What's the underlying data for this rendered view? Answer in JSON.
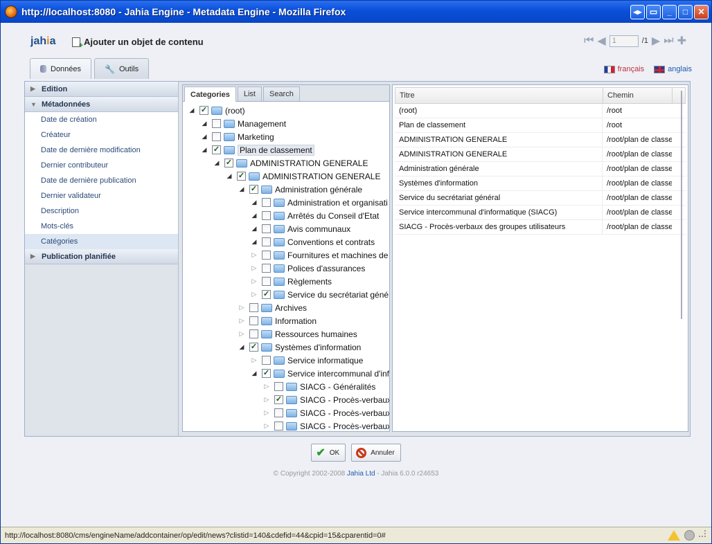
{
  "window": {
    "title": "http://localhost:8080 - Jahia Engine - Metadata Engine - Mozilla Firefox",
    "buttons": [
      "restore",
      "menu",
      "minimize",
      "maximize",
      "close"
    ]
  },
  "header": {
    "logo_main": "jah",
    "logo_accent": "i",
    "logo_end": "a",
    "heading": "Ajouter un objet de contenu",
    "page_value": "1",
    "page_total": "/1"
  },
  "tabs": [
    {
      "label": "Données",
      "icon": "database-icon",
      "active": true
    },
    {
      "label": "Outils",
      "icon": "wrench-icon",
      "active": false
    }
  ],
  "languages": [
    {
      "label": "français",
      "icon": "flag-fr-icon"
    },
    {
      "label": "anglais",
      "icon": "flag-uk-icon"
    }
  ],
  "sidebar": {
    "edition": "Edition",
    "metadonnees": "Métadonnées",
    "items": [
      "Date de création",
      "Créateur",
      "Date de dernière modification",
      "Dernier contributeur",
      "Date de dernière publication",
      "Dernier validateur",
      "Description",
      "Mots-clés",
      "Catégories"
    ],
    "selected_index": 8,
    "publication": "Publication planifiée"
  },
  "category_tabs": [
    "Categories",
    "List",
    "Search"
  ],
  "tree": [
    {
      "label": "(root)",
      "level": 0,
      "toggle": "open",
      "checked": true
    },
    {
      "label": "Management",
      "level": 1,
      "toggle": "open",
      "checked": false
    },
    {
      "label": "Marketing",
      "level": 1,
      "toggle": "open",
      "checked": false
    },
    {
      "label": "Plan de classement",
      "level": 1,
      "toggle": "open",
      "checked": true,
      "highlight": true
    },
    {
      "label": "ADMINISTRATION GENERALE",
      "level": 2,
      "toggle": "open",
      "checked": true
    },
    {
      "label": "ADMINISTRATION GENERALE",
      "level": 3,
      "toggle": "open",
      "checked": true
    },
    {
      "label": "Administration générale",
      "level": 4,
      "toggle": "open",
      "checked": true
    },
    {
      "label": "Administration et organisati",
      "level": 5,
      "toggle": "open",
      "checked": false
    },
    {
      "label": "Arrêtés du Conseil d'Etat",
      "level": 5,
      "toggle": "open",
      "checked": false
    },
    {
      "label": "Avis communaux",
      "level": 5,
      "toggle": "open",
      "checked": false
    },
    {
      "label": "Conventions et contrats",
      "level": 5,
      "toggle": "open",
      "checked": false
    },
    {
      "label": "Fournitures et machines de",
      "level": 5,
      "toggle": "closed",
      "checked": false
    },
    {
      "label": "Polices d'assurances",
      "level": 5,
      "toggle": "closed",
      "checked": false
    },
    {
      "label": "Règlements",
      "level": 5,
      "toggle": "closed",
      "checked": false
    },
    {
      "label": "Service du secrétariat géné",
      "level": 5,
      "toggle": "closed",
      "checked": true
    },
    {
      "label": "Archives",
      "level": 4,
      "toggle": "closed",
      "checked": false
    },
    {
      "label": "Information",
      "level": 4,
      "toggle": "closed",
      "checked": false
    },
    {
      "label": "Ressources humaines",
      "level": 4,
      "toggle": "closed",
      "checked": false
    },
    {
      "label": "Systèmes d'information",
      "level": 4,
      "toggle": "open",
      "checked": true
    },
    {
      "label": "Service informatique",
      "level": 5,
      "toggle": "closed",
      "checked": false
    },
    {
      "label": "Service intercommunal d'inf",
      "level": 5,
      "toggle": "open",
      "checked": true
    },
    {
      "label": "SIACG - Généralités",
      "level": 6,
      "toggle": "closed",
      "checked": false
    },
    {
      "label": "SIACG - Procès-verbaux",
      "level": 6,
      "toggle": "closed",
      "checked": true
    },
    {
      "label": "SIACG - Procès-verbaux",
      "level": 6,
      "toggle": "closed",
      "checked": false
    },
    {
      "label": "SIACG - Procès-verbaux",
      "level": 6,
      "toggle": "closed",
      "checked": false
    }
  ],
  "grid": {
    "headers": [
      "Titre",
      "Chemin"
    ],
    "rows": [
      [
        "(root)",
        "/root"
      ],
      [
        "Plan de classement",
        "/root"
      ],
      [
        "ADMINISTRATION GENERALE",
        "/root/plan de classe"
      ],
      [
        "ADMINISTRATION GENERALE",
        "/root/plan de classe"
      ],
      [
        "Administration générale",
        "/root/plan de classe"
      ],
      [
        "Systèmes d'information",
        "/root/plan de classe"
      ],
      [
        "Service du secrétariat général",
        "/root/plan de classe"
      ],
      [
        "Service intercommunal d'informatique (SIACG)",
        "/root/plan de classe"
      ],
      [
        "SIACG - Procès-verbaux des groupes utilisateurs",
        "/root/plan de classe"
      ]
    ]
  },
  "actions": {
    "ok": "OK",
    "cancel": "Annuler"
  },
  "footer": {
    "prefix": "© Copyright 2002-2008 ",
    "company": "Jahia Ltd",
    "suffix": " - Jahia 6.0.0 r24653"
  },
  "status": {
    "url": "http://localhost:8080/cms/engineName/addcontainer/op/edit/news?clistid=140&cdefid=44&cpid=15&cparentid=0#"
  }
}
